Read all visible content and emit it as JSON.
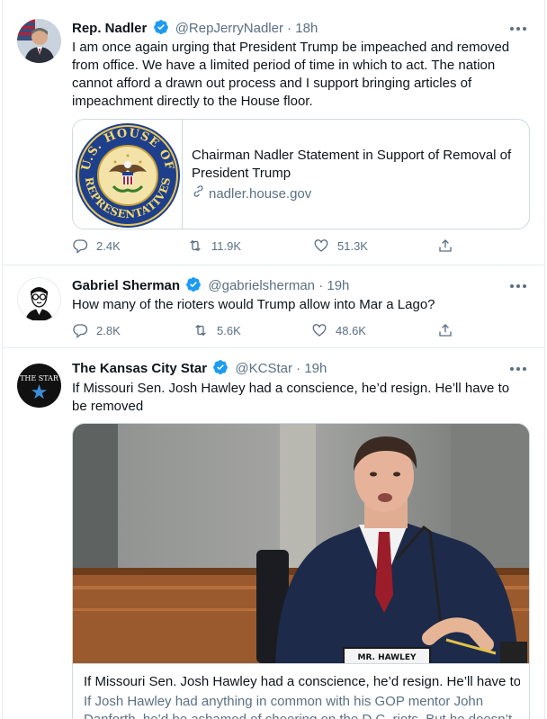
{
  "tweets": [
    {
      "name": "Rep. Nadler",
      "handle": "@RepJerryNadler",
      "time": "· 18h",
      "text": "I am once again urging that President Trump be impeached and removed from office. We have a limited period of time in which to act. The nation cannot afford a drawn out process and I support bringing articles of impeachment directly to the House floor.",
      "card": {
        "title": "Chairman Nadler Statement in Support of Removal of President Trump",
        "domain": "nadler.house.gov",
        "seal_text": [
          "U.S. HOUSE OF",
          "REPRESENTATIVES"
        ]
      },
      "replies": "2.4K",
      "retweets": "11.9K",
      "likes": "51.3K"
    },
    {
      "name": "Gabriel Sherman",
      "handle": "@gabrielsherman",
      "time": "· 19h",
      "text": "How many of the rioters would Trump allow into Mar a Lago?",
      "replies": "2.8K",
      "retweets": "5.6K",
      "likes": "48.6K"
    },
    {
      "name": "The Kansas City Star",
      "handle": "@KCStar",
      "time": "· 19h",
      "text": "If Missouri Sen. Josh Hawley had a conscience, he’d resign. He’ll have to be removed",
      "avatar_text": "THE STAR",
      "card": {
        "nameplate": "MR. HAWLEY",
        "title": "If Missouri Sen. Josh Hawley had a conscience, he’d resign. He’ll have to ...",
        "description": "If Josh Hawley had anything in common with his GOP mentor John Danforth, he’d be ashamed of cheering on the D.C. riots. But he doesn’t."
      }
    }
  ],
  "colors": {
    "verified": "#1d9bf0",
    "secondary_text": "#5b7083",
    "border": "#e6ecf0"
  }
}
